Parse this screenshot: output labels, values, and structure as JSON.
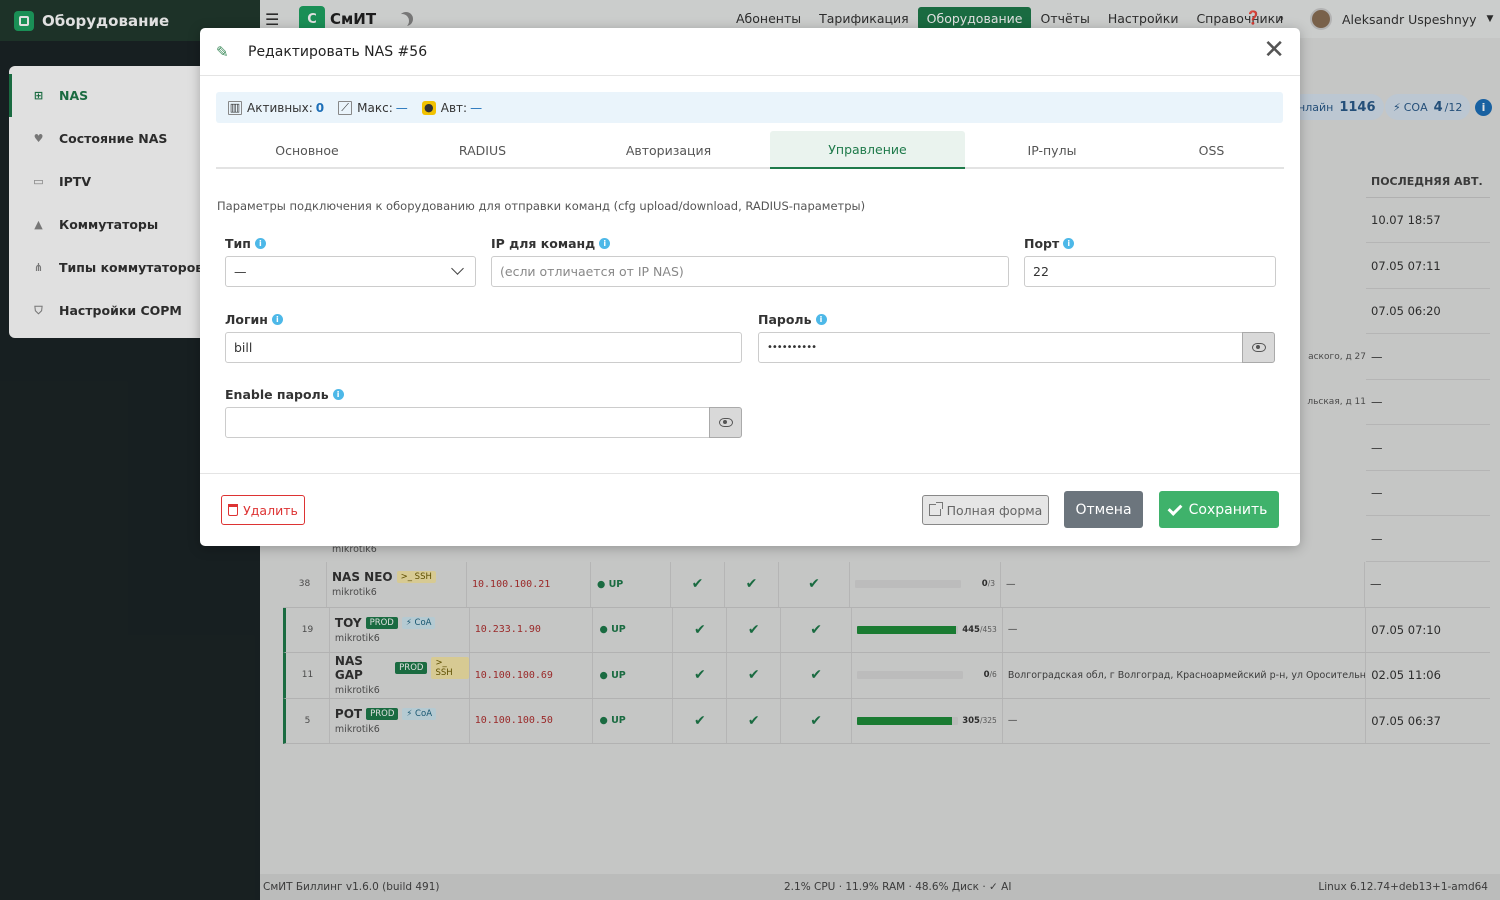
{
  "sidebar": {
    "title": "Оборудование",
    "items": [
      {
        "label": "NAS",
        "icon": "network-icon",
        "active": true
      },
      {
        "label": "Состояние NAS",
        "icon": "heart-icon"
      },
      {
        "label": "IPTV",
        "icon": "tv-icon"
      },
      {
        "label": "Коммутаторы",
        "icon": "switch-icon"
      },
      {
        "label": "Типы коммутаторов",
        "icon": "sitemap-icon"
      },
      {
        "label": "Настройки СОРМ",
        "icon": "shield-icon"
      }
    ]
  },
  "topnav": {
    "brand_letter": "С",
    "brand": "СмИТ",
    "links": [
      "Абоненты",
      "Тарификация",
      "Оборудование",
      "Отчёты",
      "Настройки",
      "Справочники"
    ],
    "active_link": "Оборудование",
    "user": "Aleksandr Uspeshnyy"
  },
  "background": {
    "online_label": "нлайн",
    "online_count": "1146",
    "coa_label": "СОА",
    "coa_count": "4",
    "coa_total": "/12",
    "last_auth_header": "ПОСЛЕДНЯЯ АВТ.",
    "upper_rows": [
      {
        "last": "10.07 18:57",
        "addr": ""
      },
      {
        "last": "07.05 07:11",
        "addr": ""
      },
      {
        "last": "07.05 06:20",
        "addr": ""
      },
      {
        "last": "—",
        "addr": "аского, д 27"
      },
      {
        "last": "—",
        "addr": "льская, д 11"
      },
      {
        "last": "—",
        "addr": ""
      },
      {
        "last": "—",
        "addr": ""
      },
      {
        "last": "—",
        "addr": ""
      }
    ],
    "partial_sub": "mikrotik6",
    "rows": [
      {
        "id": "38",
        "name": "NAS NEO",
        "tags": [
          {
            "t": "ssh",
            "l": ">_ SSH"
          }
        ],
        "sub": "mikrotik6",
        "ip": "10.100.100.21",
        "status": "● UP",
        "bar": 0,
        "used": "0",
        "total": "/3",
        "addr": "—",
        "last": "—",
        "hl": false
      },
      {
        "id": "19",
        "name": "TOY",
        "tags": [
          {
            "t": "prod",
            "l": "PROD"
          },
          {
            "t": "coa",
            "l": "⚡ CoA"
          }
        ],
        "sub": "mikrotik6",
        "ip": "10.233.1.90",
        "status": "● UP",
        "bar": 0.98,
        "used": "445",
        "total": "/453",
        "addr": "—",
        "last": "07.05 07:10",
        "hl": true
      },
      {
        "id": "11",
        "name": "NAS GAP",
        "tags": [
          {
            "t": "prod",
            "l": "PROD"
          },
          {
            "t": "ssh",
            "l": ">_ SSH"
          }
        ],
        "sub": "mikrotik6",
        "ip": "10.100.100.69",
        "status": "● UP",
        "bar": 0,
        "used": "0",
        "total": "/6",
        "addr": "Волгоградская обл, г Волгоград, Красноармейский р-н, ул Оросительная, д 15",
        "last": "02.05 11:06",
        "hl": true
      },
      {
        "id": "5",
        "name": "POT",
        "tags": [
          {
            "t": "prod",
            "l": "PROD"
          },
          {
            "t": "coa",
            "l": "⚡ CoA"
          }
        ],
        "sub": "mikrotik6",
        "ip": "10.100.100.50",
        "status": "● UP",
        "bar": 0.94,
        "used": "305",
        "total": "/325",
        "addr": "—",
        "last": "07.05 06:37",
        "hl": true
      }
    ]
  },
  "footer": {
    "left": "СмИТ Биллинг v1.6.0 (build 491)",
    "mid": "2.1% CPU · 11.9% RAM · 48.6% Диск · ✓ AI",
    "right": "Linux 6.12.74+deb13+1-amd64"
  },
  "modal": {
    "title": "Редактировать NAS #56",
    "stats": {
      "active_label": "Активных:",
      "active_value": "0",
      "max_label": "Макс:",
      "max_value": "—",
      "auth_label": "Авт:",
      "auth_value": "—"
    },
    "tabs": [
      "Основное",
      "RADIUS",
      "Авторизация",
      "Управление",
      "IP-пулы",
      "OSS"
    ],
    "active_tab": "Управление",
    "description": "Параметры подключения к оборудованию для отправки команд (cfg upload/download, RADIUS-параметры)",
    "fields": {
      "type_label": "Тип",
      "type_value": "—",
      "ip_label": "IP для команд",
      "ip_placeholder": "(если отличается от IP NAS)",
      "port_label": "Порт",
      "port_value": "22",
      "login_label": "Логин",
      "login_value": "bill",
      "password_label": "Пароль",
      "password_value": "••••••••••",
      "enable_label": "Enable пароль",
      "enable_value": ""
    },
    "buttons": {
      "delete": "Удалить",
      "full_form": "Полная форма",
      "cancel": "Отмена",
      "save": "Сохранить"
    }
  },
  "colors": {
    "accent": "#1e7a4a",
    "save": "#3fb26b",
    "danger": "#dd3333"
  }
}
